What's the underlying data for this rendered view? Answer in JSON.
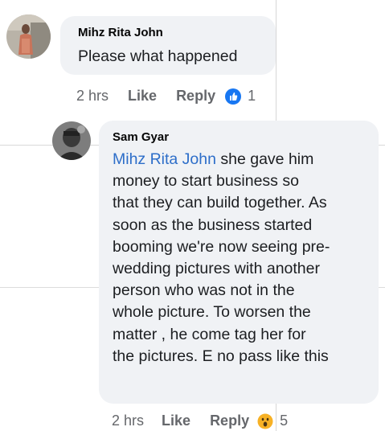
{
  "comments": [
    {
      "author": "Mihz Rita John",
      "text": "Please what happened",
      "time": "2 hrs",
      "like_label": "Like",
      "reply_label": "Reply",
      "reaction_icon": "like-icon",
      "reaction_count": "1"
    },
    {
      "author": "Sam Gyar",
      "mention": "Mihz Rita John",
      "text_lines": [
        " she gave him",
        "money to start business so",
        "that they can build together. As",
        "soon as the business started",
        "booming we're now seeing pre-",
        "wedding pictures with another",
        "person who was not in the",
        "whole picture. To worsen the",
        "matter , he come tag her for",
        "the pictures. E no pass like this"
      ],
      "time": "2 hrs",
      "like_label": "Like",
      "reply_label": "Reply",
      "reaction_icon": "wow-icon",
      "reaction_count": "5"
    }
  ],
  "colors": {
    "bubble": "#f0f2f5",
    "mention": "#2d6ec9",
    "like_blue": "#1877f2",
    "wow_yellow": "#f7b125"
  }
}
